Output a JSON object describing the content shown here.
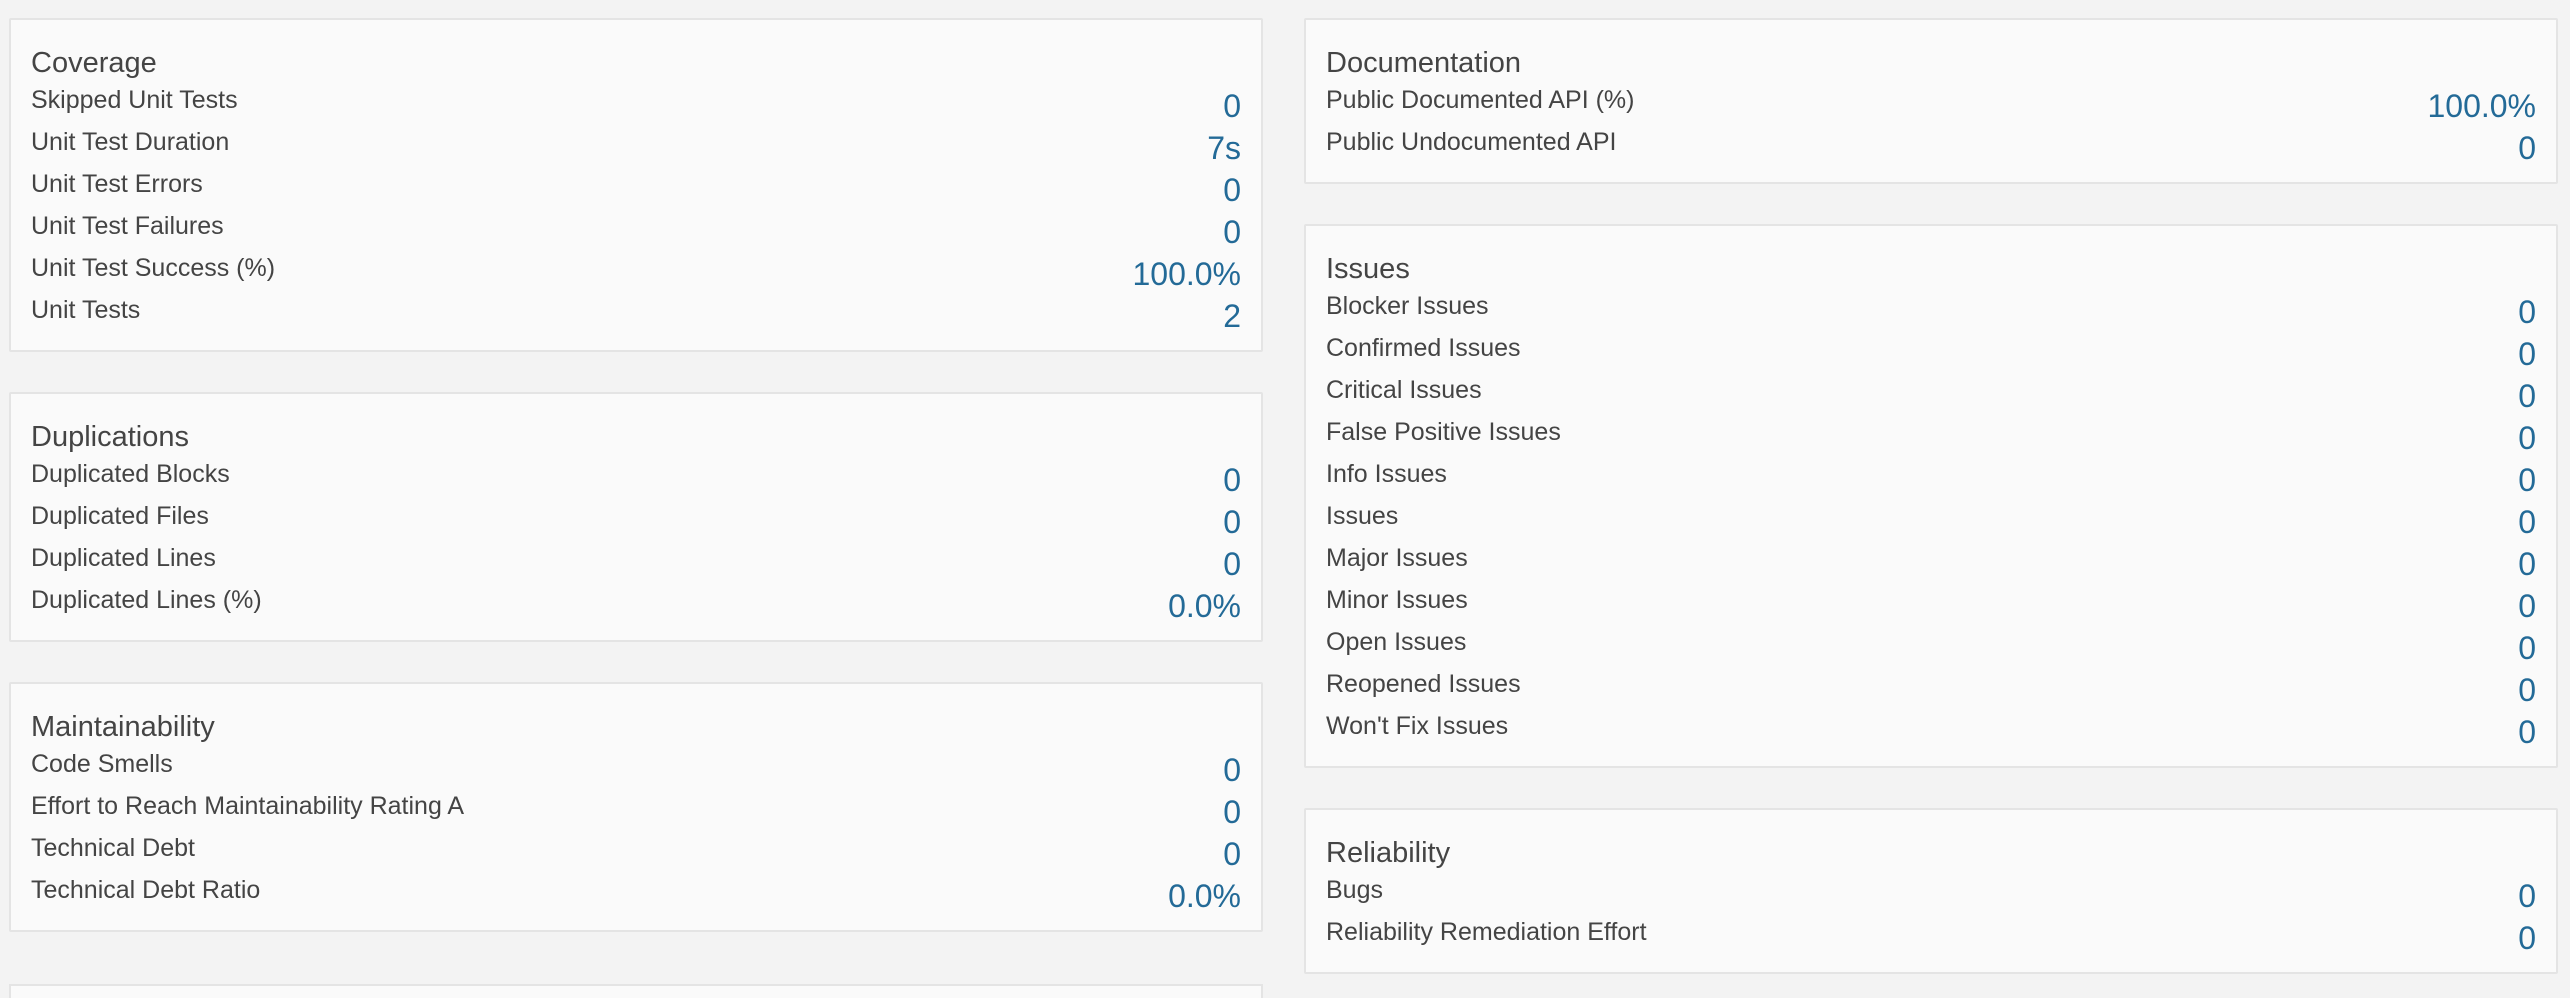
{
  "left_column": [
    {
      "title": "Coverage",
      "metrics": [
        {
          "label": "Skipped Unit Tests",
          "value": "0"
        },
        {
          "label": "Unit Test Duration",
          "value": "7s"
        },
        {
          "label": "Unit Test Errors",
          "value": "0"
        },
        {
          "label": "Unit Test Failures",
          "value": "0"
        },
        {
          "label": "Unit Test Success (%)",
          "value": "100.0%"
        },
        {
          "label": "Unit Tests",
          "value": "2"
        }
      ]
    },
    {
      "title": "Duplications",
      "metrics": [
        {
          "label": "Duplicated Blocks",
          "value": "0"
        },
        {
          "label": "Duplicated Files",
          "value": "0"
        },
        {
          "label": "Duplicated Lines",
          "value": "0"
        },
        {
          "label": "Duplicated Lines (%)",
          "value": "0.0%"
        }
      ]
    },
    {
      "title": "Maintainability",
      "metrics": [
        {
          "label": "Code Smells",
          "value": "0"
        },
        {
          "label": "Effort to Reach Maintainability Rating A",
          "value": "0"
        },
        {
          "label": "Technical Debt",
          "value": "0"
        },
        {
          "label": "Technical Debt Ratio",
          "value": "0.0%"
        }
      ]
    }
  ],
  "right_column": [
    {
      "title": "Documentation",
      "metrics": [
        {
          "label": "Public Documented API (%)",
          "value": "100.0%"
        },
        {
          "label": "Public Undocumented API",
          "value": "0"
        }
      ]
    },
    {
      "title": "Issues",
      "metrics": [
        {
          "label": "Blocker Issues",
          "value": "0"
        },
        {
          "label": "Confirmed Issues",
          "value": "0"
        },
        {
          "label": "Critical Issues",
          "value": "0"
        },
        {
          "label": "False Positive Issues",
          "value": "0"
        },
        {
          "label": "Info Issues",
          "value": "0"
        },
        {
          "label": "Issues",
          "value": "0"
        },
        {
          "label": "Major Issues",
          "value": "0"
        },
        {
          "label": "Minor Issues",
          "value": "0"
        },
        {
          "label": "Open Issues",
          "value": "0"
        },
        {
          "label": "Reopened Issues",
          "value": "0"
        },
        {
          "label": "Won't Fix Issues",
          "value": "0"
        }
      ]
    },
    {
      "title": "Reliability",
      "metrics": [
        {
          "label": "Bugs",
          "value": "0"
        },
        {
          "label": "Reliability Remediation Effort",
          "value": "0"
        }
      ]
    }
  ],
  "colors": {
    "value_link": "#236a97",
    "text": "#444444",
    "card_bg": "#fafafa",
    "page_bg": "#f3f3f3",
    "card_border": "#e4e4e4"
  }
}
